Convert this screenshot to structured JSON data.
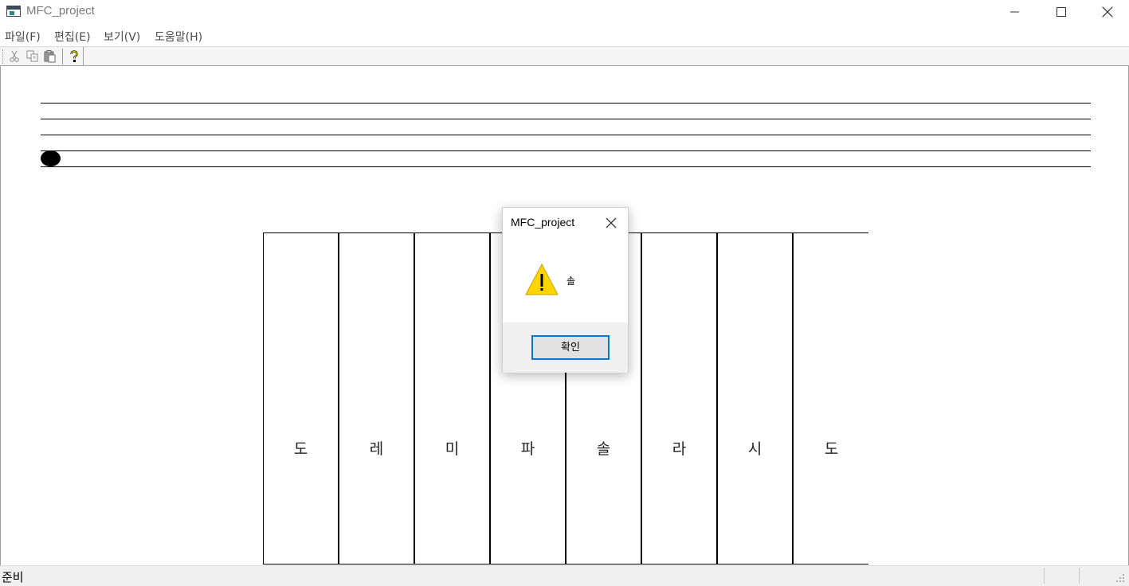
{
  "window": {
    "title": "MFC_project"
  },
  "menu": {
    "items": [
      "파일(F)",
      "편집(E)",
      "보기(V)",
      "도움말(H)"
    ]
  },
  "toolbar": {
    "buttons": [
      "cut-icon",
      "copy-icon",
      "paste-icon",
      "help-icon"
    ]
  },
  "staff": {
    "line_count": 5
  },
  "keyboard": {
    "keys": [
      "도",
      "레",
      "미",
      "파",
      "솔",
      "라",
      "시",
      "도"
    ]
  },
  "dialog": {
    "title": "MFC_project",
    "message": "솔",
    "ok_label": "확인",
    "icon": "warning-icon"
  },
  "status": {
    "text": "준비"
  },
  "colors": {
    "accent": "#0078d7",
    "warning": "#ffd500"
  }
}
